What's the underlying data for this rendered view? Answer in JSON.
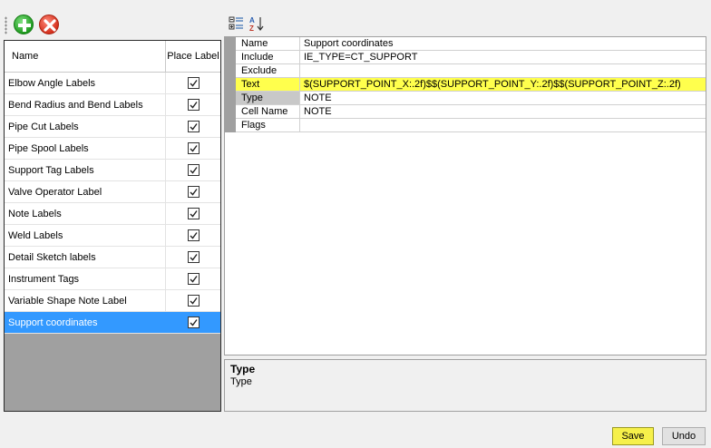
{
  "left_toolbar": {
    "add_icon": "plus-circle-icon",
    "delete_icon": "x-circle-icon"
  },
  "label_list": {
    "columns": [
      "Name",
      "Place Label"
    ],
    "rows": [
      {
        "name": "Elbow Angle Labels",
        "checked": true
      },
      {
        "name": "Bend Radius and Bend Labels",
        "checked": true
      },
      {
        "name": "Pipe Cut Labels",
        "checked": true
      },
      {
        "name": "Pipe Spool Labels",
        "checked": true
      },
      {
        "name": "Support Tag Labels",
        "checked": true
      },
      {
        "name": "Valve Operator Label",
        "checked": true
      },
      {
        "name": "Note Labels",
        "checked": true
      },
      {
        "name": "Weld Labels",
        "checked": true
      },
      {
        "name": "Detail Sketch labels",
        "checked": true
      },
      {
        "name": "Instrument Tags",
        "checked": true
      },
      {
        "name": "Variable Shape Note Label",
        "checked": true
      },
      {
        "name": "Support coordinates",
        "checked": true,
        "selected": true
      }
    ]
  },
  "right_toolbar": {
    "categorized_icon": "categorized-icon",
    "sort_az_icon": "sort-alphabetical-icon"
  },
  "properties": [
    {
      "name": "Name",
      "value": "Support coordinates"
    },
    {
      "name": "Include",
      "value": "IE_TYPE=CT_SUPPORT"
    },
    {
      "name": "Exclude",
      "value": ""
    },
    {
      "name": "Text",
      "value": "$(SUPPORT_POINT_X:.2f)$$(SUPPORT_POINT_Y:.2f)$$(SUPPORT_POINT_Z:.2f)",
      "highlighted": true
    },
    {
      "name": "Type",
      "value": "NOTE",
      "selected": true
    },
    {
      "name": "Cell Name",
      "value": "NOTE"
    },
    {
      "name": "Flags",
      "value": ""
    }
  ],
  "description": {
    "title": "Type",
    "text": "Type"
  },
  "buttons": {
    "save": "Save",
    "undo": "Undo"
  },
  "colors": {
    "selection": "#3399ff",
    "highlight": "#ffff4d",
    "save_highlight": "#f6f04a"
  }
}
